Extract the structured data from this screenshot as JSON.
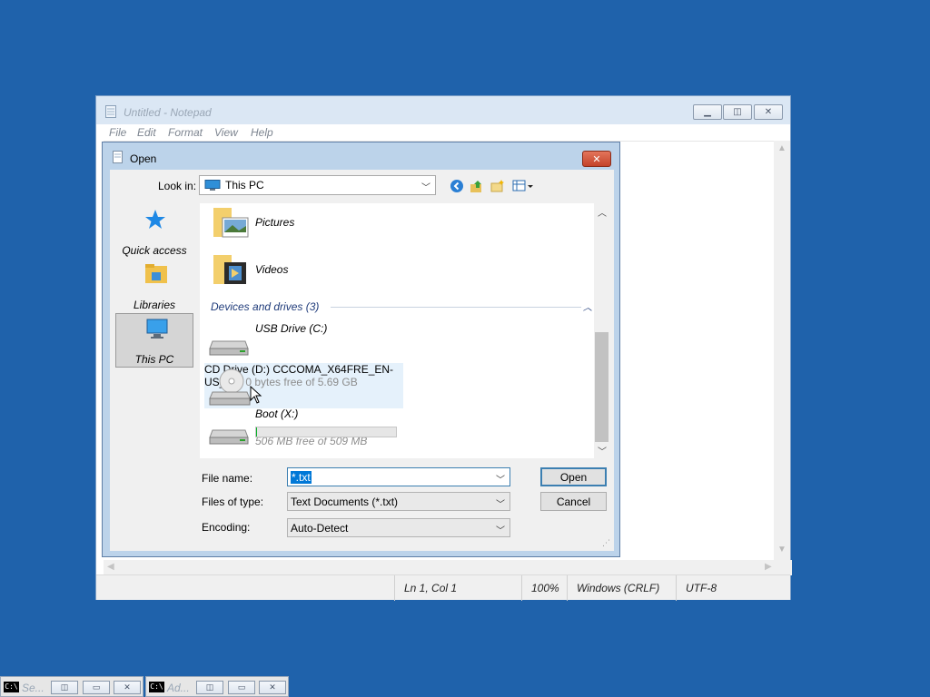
{
  "notepad": {
    "title": "Untitled - Notepad",
    "menu": [
      "File",
      "Edit",
      "Format",
      "View",
      "Help"
    ],
    "status": {
      "position": "Ln 1, Col 1",
      "zoom": "100%",
      "line_ending": "Windows (CRLF)",
      "encoding": "UTF-8"
    }
  },
  "dialog": {
    "title": "Open",
    "look_in_label": "Look in:",
    "look_in_value": "This PC",
    "places": [
      "Quick access",
      "Libraries",
      "This PC"
    ],
    "items": {
      "pictures": "Pictures",
      "videos": "Videos",
      "group_header": "Devices and drives (3)",
      "usb": "USB Drive (C:)",
      "cd_name": "CD Drive (D:)",
      "cd_label": "CCCOMA_X64FRE_EN-US_D...",
      "cd_free": "0 bytes free of 5.69 GB",
      "boot": "Boot (X:)",
      "boot_free": "506 MB free of 509 MB",
      "boot_used_fraction": 0.006
    },
    "file_name_label": "File name:",
    "file_name_value": "*.txt",
    "files_of_type_label": "Files of type:",
    "files_of_type_value": "Text Documents (*.txt)",
    "encoding_label": "Encoding:",
    "encoding_value": "Auto-Detect",
    "open_label": "Open",
    "cancel_label": "Cancel"
  },
  "taskbar": {
    "items": [
      "Se...",
      "Ad..."
    ]
  },
  "colors": {
    "desktop": "#1f62ab",
    "selection": "#0078d7",
    "hover": "#e5f1fb"
  }
}
